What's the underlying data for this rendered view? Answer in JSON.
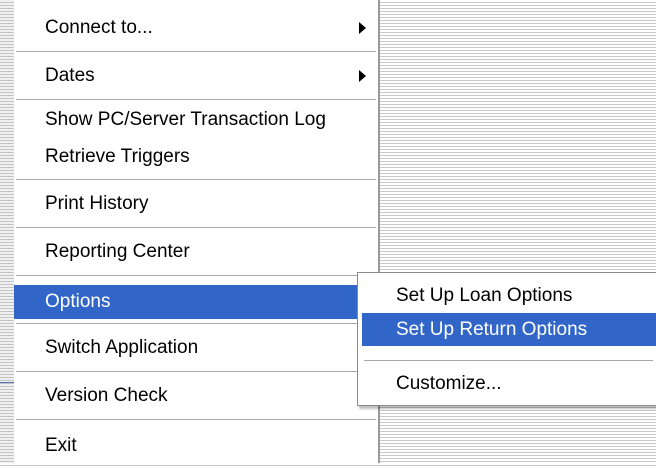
{
  "menu": {
    "connect_to": "Connect to...",
    "dates": "Dates",
    "show_log": "Show PC/Server Transaction Log",
    "retrieve_triggers": "Retrieve Triggers",
    "print_history": "Print History",
    "reporting_center": "Reporting Center",
    "options": "Options",
    "switch_application": "Switch Application",
    "version_check": "Version Check",
    "exit": "Exit"
  },
  "submenu": {
    "loan_options": "Set Up Loan Options",
    "return_options": "Set Up Return Options",
    "customize": "Customize..."
  },
  "colors": {
    "highlight": "#3166c8",
    "highlight_text": "#ffffff"
  }
}
